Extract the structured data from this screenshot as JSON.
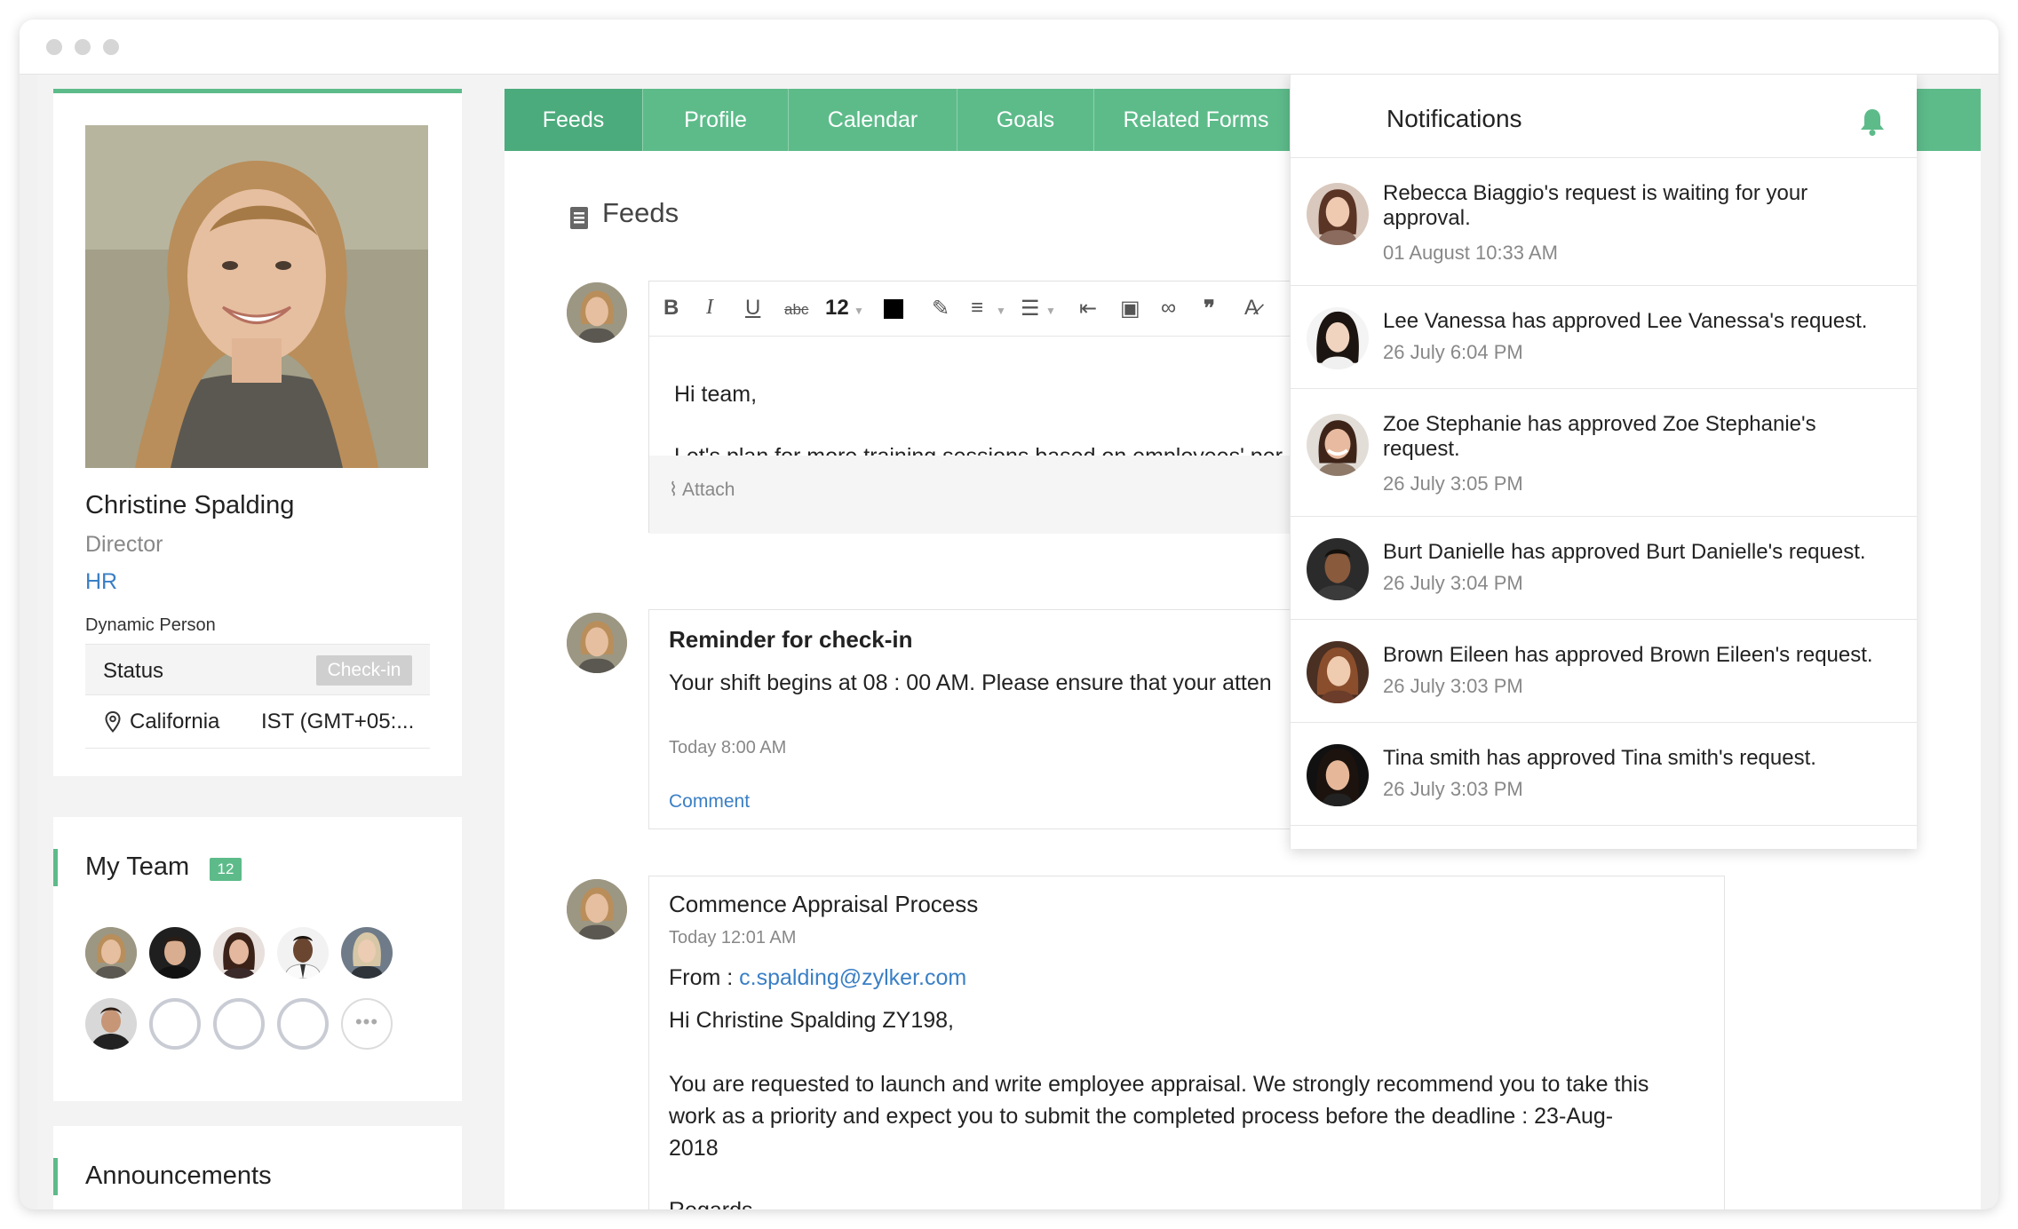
{
  "profile": {
    "name": "Christine Spalding",
    "designation": "Director",
    "department": "HR",
    "tag": "Dynamic Person",
    "status_label": "Status",
    "checkin_label": "Check-in",
    "location": "California",
    "timezone": "IST (GMT+05:..."
  },
  "team": {
    "title": "My Team",
    "count": "12",
    "more_label": "•••"
  },
  "announcements": {
    "title": "Announcements"
  },
  "tabs": [
    {
      "label": "Feeds"
    },
    {
      "label": "Profile"
    },
    {
      "label": "Calendar"
    },
    {
      "label": "Goals"
    },
    {
      "label": "Related Forms"
    }
  ],
  "feeds": {
    "title": "Feeds",
    "editor": {
      "font_size": "12",
      "line1": "Hi team,",
      "line2": "Let's plan for more training sessions based on employees' per",
      "attach_label": "Attach"
    },
    "reminder": {
      "title": "Reminder for check-in",
      "text": "Your shift begins at 08 : 00 AM. Please ensure that your atten",
      "time": "Today 8:00 AM",
      "comment_label": "Comment"
    },
    "appraisal": {
      "title": "Commence Appraisal Process",
      "time": "Today 12:01 AM",
      "from_label": "From :",
      "from_email": "c.spalding@zylker.com",
      "greeting": "Hi Christine Spalding ZY198,",
      "body_line1": "You are requested to launch and write employee appraisal. We strongly recommend you to take this",
      "body_line2": "work as a priority and expect you to submit the completed process before the deadline : 23-Aug-",
      "body_line3": "2018",
      "regards": "Regards"
    }
  },
  "notifications": {
    "title": "Notifications",
    "items": [
      {
        "text": "Rebecca Biaggio's request is waiting for your approval.",
        "time": "01 August 10:33 AM"
      },
      {
        "text": "Lee Vanessa has approved Lee Vanessa's request.",
        "time": "26 July 6:04 PM"
      },
      {
        "text": "Zoe Stephanie has approved Zoe Stephanie's request.",
        "time": "26 July 3:05 PM"
      },
      {
        "text": "Burt Danielle has approved Burt Danielle's request.",
        "time": "26 July 3:04 PM"
      },
      {
        "text": "Brown Eileen has approved Brown Eileen's request.",
        "time": "26 July 3:03 PM"
      },
      {
        "text": "Tina smith has approved Tina smith's request.",
        "time": "26 July 3:03 PM"
      }
    ]
  },
  "colors": {
    "accent": "#5dbb8a",
    "link": "#3a7fc5",
    "muted": "#888888"
  }
}
